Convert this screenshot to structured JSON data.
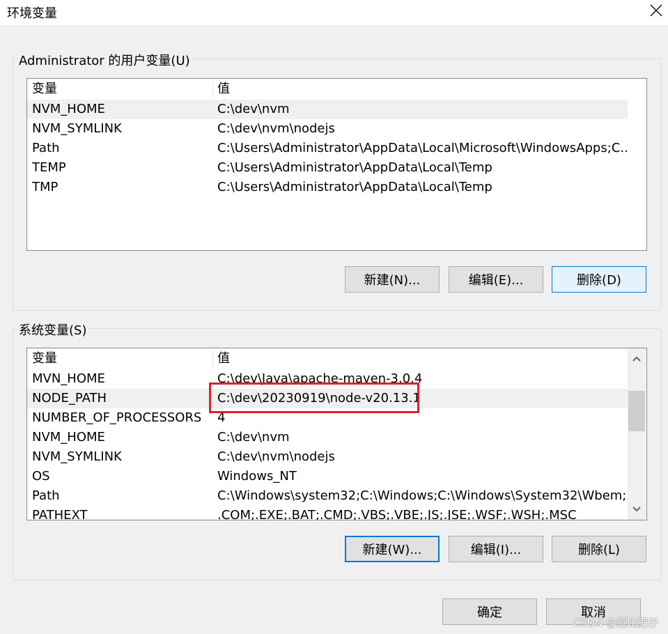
{
  "window": {
    "title": "环境变量"
  },
  "user_vars": {
    "group_label": "Administrator 的用户变量(U)",
    "col_name": "变量",
    "col_value": "值",
    "rows": [
      {
        "name": "NVM_HOME",
        "value": "C:\\dev\\nvm"
      },
      {
        "name": "NVM_SYMLINK",
        "value": "C:\\dev\\nvm\\nodejs"
      },
      {
        "name": "Path",
        "value": "C:\\Users\\Administrator\\AppData\\Local\\Microsoft\\WindowsApps;C..."
      },
      {
        "name": "TEMP",
        "value": "C:\\Users\\Administrator\\AppData\\Local\\Temp"
      },
      {
        "name": "TMP",
        "value": "C:\\Users\\Administrator\\AppData\\Local\\Temp"
      }
    ],
    "selected_index": 0,
    "buttons": {
      "new": "新建(N)...",
      "edit": "编辑(E)...",
      "delete": "删除(D)"
    }
  },
  "system_vars": {
    "group_label": "系统变量(S)",
    "col_name": "变量",
    "col_value": "值",
    "rows": [
      {
        "name": "MVN_HOME",
        "value": "C:\\dev\\Java\\apache-maven-3.0.4"
      },
      {
        "name": "NODE_PATH",
        "value": "C:\\dev\\20230919\\node-v20.13.1"
      },
      {
        "name": "NUMBER_OF_PROCESSORS",
        "value": "4"
      },
      {
        "name": "NVM_HOME",
        "value": "C:\\dev\\nvm"
      },
      {
        "name": "NVM_SYMLINK",
        "value": "C:\\dev\\nvm\\nodejs"
      },
      {
        "name": "OS",
        "value": "Windows_NT"
      },
      {
        "name": "Path",
        "value": "C:\\Windows\\system32;C:\\Windows;C:\\Windows\\System32\\Wbem;..."
      },
      {
        "name": "PATHEXT",
        "value": ".COM;.EXE;.BAT;.CMD;.VBS;.VBE;.JS;.JSE;.WSF;.WSH;.MSC"
      }
    ],
    "selected_index": 1,
    "buttons": {
      "new": "新建(W)...",
      "edit": "编辑(I)...",
      "delete": "删除(L)"
    }
  },
  "footer": {
    "ok": "确定",
    "cancel": "取消"
  },
  "watermark": "CSDN @逗比肥仔",
  "icons": {
    "close": "close-icon",
    "scroll_up": "chevron-up-icon",
    "scroll_down": "chevron-down-icon"
  }
}
